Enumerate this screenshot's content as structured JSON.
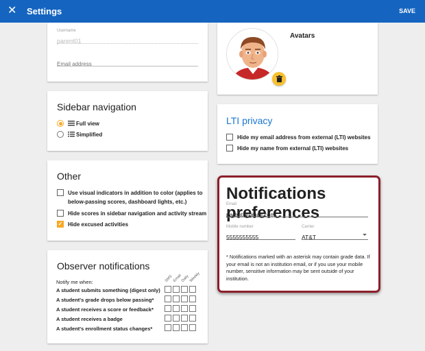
{
  "header": {
    "title": "Settings",
    "save_label": "SAVE"
  },
  "account": {
    "username_label": "Username",
    "username_value": "parent01",
    "email_placeholder": "Email address"
  },
  "sidebar_nav": {
    "title": "Sidebar navigation",
    "options": [
      {
        "label": "Full view",
        "selected": true
      },
      {
        "label": "Simplified",
        "selected": false
      }
    ]
  },
  "other": {
    "title": "Other",
    "items": [
      {
        "label": "Use visual indicators in addition to color (applies to below-passing scores, dashboard lights, etc.)",
        "checked": false
      },
      {
        "label": "Hide scores in sidebar navigation and activity stream",
        "checked": false
      },
      {
        "label": "Hide excused activities",
        "checked": true
      }
    ]
  },
  "observer": {
    "title": "Observer notifications",
    "notify_label": "Notify me when:",
    "columns": [
      "SMS",
      "Email",
      "Daily",
      "Weekly"
    ],
    "rows": [
      "A student submits something (digest only)",
      "A student's grade drops below passing*",
      "A student receives a score or feedback*",
      "A student receives a badge",
      "A student's enrollment status changes*"
    ]
  },
  "avatars": {
    "title": "Avatars"
  },
  "lti": {
    "title": "LTI privacy",
    "items": [
      {
        "label": "Hide my email address from external (LTI) websites",
        "checked": false
      },
      {
        "label": "Hide my name from external (LTI) websites",
        "checked": false
      }
    ]
  },
  "notifications": {
    "title": "Notifications preferences",
    "email_label": "Email",
    "email_value": "parent@gmail.com",
    "mobile_label": "Mobile number",
    "mobile_value": "5555555555",
    "carrier_label": "Carrier",
    "carrier_value": "AT&T",
    "note": "* Notifications marked with an asterisk may contain grade data. If your email is not an institution email, or if you use your mobile number, sensitive information may be sent outside of your institution."
  },
  "colors": {
    "primary": "#1565c0",
    "accent": "#f9a825",
    "highlight_border": "#8b1f2a",
    "link_blue": "#1976d2"
  }
}
